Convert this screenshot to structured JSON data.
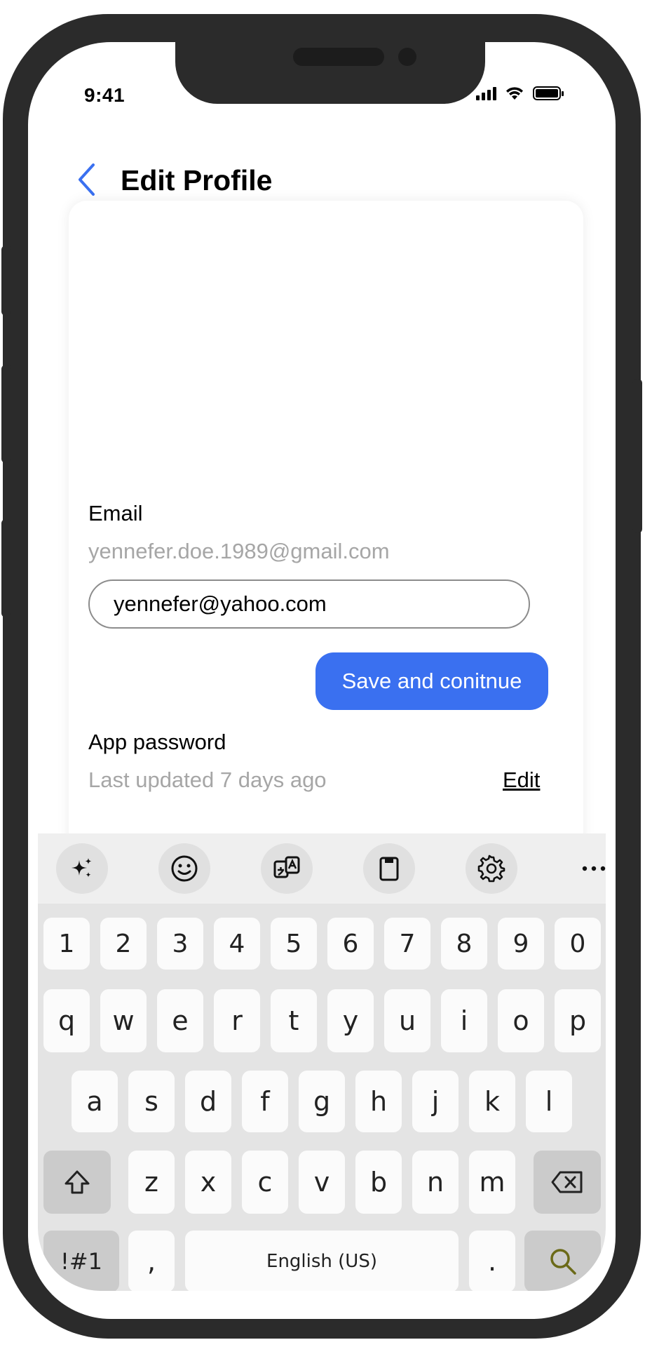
{
  "status_bar": {
    "time": "9:41"
  },
  "header": {
    "title": "Edit Profile"
  },
  "email": {
    "label": "Email",
    "current": "yennefer.doe.1989@gmail.com",
    "input_value": "yennefer@yahoo.com"
  },
  "save_button": {
    "label": "Save and conitnue"
  },
  "app_password": {
    "label": "App password",
    "updated": "Last updated 7 days ago",
    "edit_label": "Edit"
  },
  "keyboard": {
    "toolbar": [
      "sparkle-icon",
      "emoji-icon",
      "translate-icon",
      "clipboard-icon",
      "gear-icon",
      "more-icon"
    ],
    "number_row": [
      "1",
      "2",
      "3",
      "4",
      "5",
      "6",
      "7",
      "8",
      "9",
      "0"
    ],
    "row1": [
      "q",
      "w",
      "e",
      "r",
      "t",
      "y",
      "u",
      "i",
      "o",
      "p"
    ],
    "row2": [
      "a",
      "s",
      "d",
      "f",
      "g",
      "h",
      "j",
      "k",
      "l"
    ],
    "row3": [
      "z",
      "x",
      "c",
      "v",
      "b",
      "n",
      "m"
    ],
    "symbols_key": "!#1",
    "comma_key": ",",
    "space_key": "English (US)",
    "period_key": "."
  },
  "colors": {
    "accent": "#3a70f0",
    "muted_text": "#a6a6a6",
    "search_icon": "#6b6a18"
  }
}
